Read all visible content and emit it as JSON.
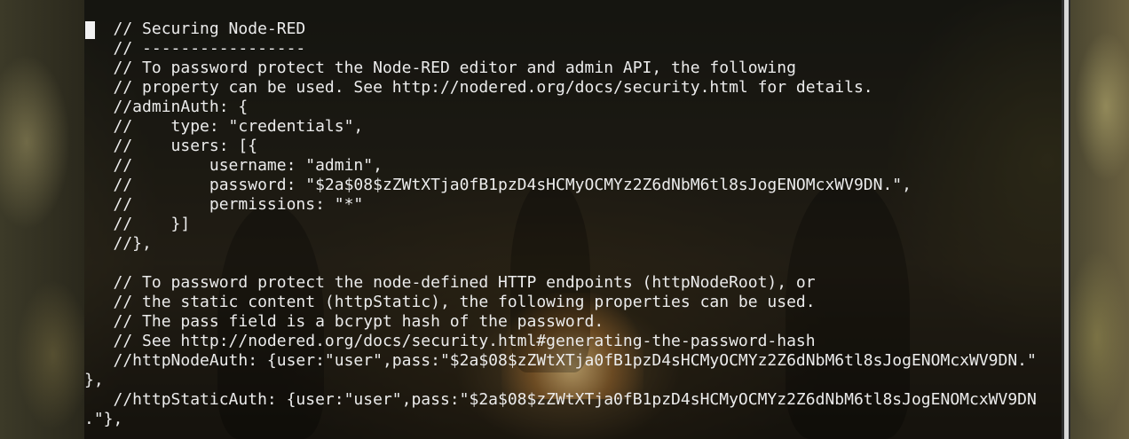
{
  "terminal": {
    "lines": [
      "   // Securing Node-RED",
      "   // -----------------",
      "   // To password protect the Node-RED editor and admin API, the following",
      "   // property can be used. See http://nodered.org/docs/security.html for details.",
      "   //adminAuth: {",
      "   //    type: \"credentials\",",
      "   //    users: [{",
      "   //        username: \"admin\",",
      "   //        password: \"$2a$08$zZWtXTja0fB1pzD4sHCMyOCMYz2Z6dNbM6tl8sJogENOMcxWV9DN.\",",
      "   //        permissions: \"*\"",
      "   //    }]",
      "   //},",
      "",
      "   // To password protect the node-defined HTTP endpoints (httpNodeRoot), or",
      "   // the static content (httpStatic), the following properties can be used.",
      "   // The pass field is a bcrypt hash of the password.",
      "   // See http://nodered.org/docs/security.html#generating-the-password-hash",
      "   //httpNodeAuth: {user:\"user\",pass:\"$2a$08$zZWtXTja0fB1pzD4sHCMyOCMYz2Z6dNbM6tl8sJogENOMcxWV9DN.\"",
      "},",
      "   //httpStaticAuth: {user:\"user\",pass:\"$2a$08$zZWtXTja0fB1pzD4sHCMyOCMYz2Z6dNbM6tl8sJogENOMcxWV9DN",
      ".\"},"
    ]
  },
  "colors": {
    "text": "#ececec",
    "cursor": "#f2f2f2",
    "scrollbar_thumb": "#d8d8d8"
  }
}
